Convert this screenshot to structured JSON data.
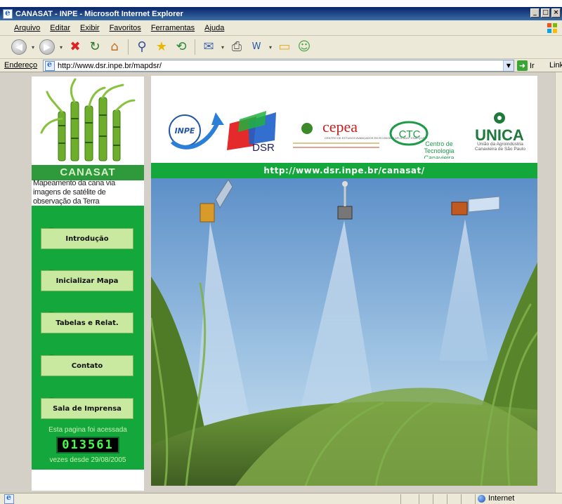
{
  "window": {
    "title": "CANASAT - INPE - Microsoft Internet Explorer",
    "minimize": "_",
    "maximize": "□",
    "close": "×"
  },
  "menu": {
    "items": [
      "Arquivo",
      "Editar",
      "Exibir",
      "Favoritos",
      "Ferramentas",
      "Ajuda"
    ]
  },
  "toolbar": {
    "back_glyph": "◀",
    "forward_glyph": "▶",
    "stop_glyph": "✖",
    "refresh_glyph": "↻",
    "home_glyph": "⌂",
    "search_glyph": "⚲",
    "favorites_glyph": "★",
    "history_glyph": "⟲",
    "mail_glyph": "✉",
    "print_glyph": "⎙",
    "edit_glyph": "W",
    "folder_glyph": "▭",
    "messenger_glyph": "☺"
  },
  "address": {
    "label": "Endereço",
    "url": "http://www.dsr.inpe.br/mapdsr/",
    "go_label": "Ir",
    "links_label": "Links"
  },
  "page": {
    "logo_title": "CANASAT",
    "logo_subtitle": "Mapeamento da cana via imagens de satélite de observação da Terra",
    "nav": [
      {
        "label": "Introdução"
      },
      {
        "label": "Inicializar Mapa"
      },
      {
        "label": "Tabelas e Relat."
      },
      {
        "label": "Contato"
      },
      {
        "label": "Sala de Imprensa"
      }
    ],
    "counter": {
      "caption_top": "Esta pagina foi acessada",
      "value": "013561",
      "caption_bottom": "vezes desde 29/08/2005"
    },
    "sponsors": {
      "inpe": "INPE",
      "dsr": "DSR",
      "cepea": "cepea",
      "cepea_sub": "CENTRO DE ESTUDOS AVANÇADOS EM ECONOMIA APLICADA - ESALQ-USP",
      "ctc": "CTC",
      "ctc_name": "Centro de Tecnologia Canavieira",
      "unica": "UNICA",
      "unica_sub": "União da Agroindústria Canavieira de São Paulo"
    },
    "site_url": "http://www.dsr.inpe.br/canasat/"
  },
  "status": {
    "zone": "Internet"
  },
  "colors": {
    "brand_green": "#14a83c",
    "button_green": "#c9e8a0",
    "counter_digits": "#41ff4a"
  }
}
